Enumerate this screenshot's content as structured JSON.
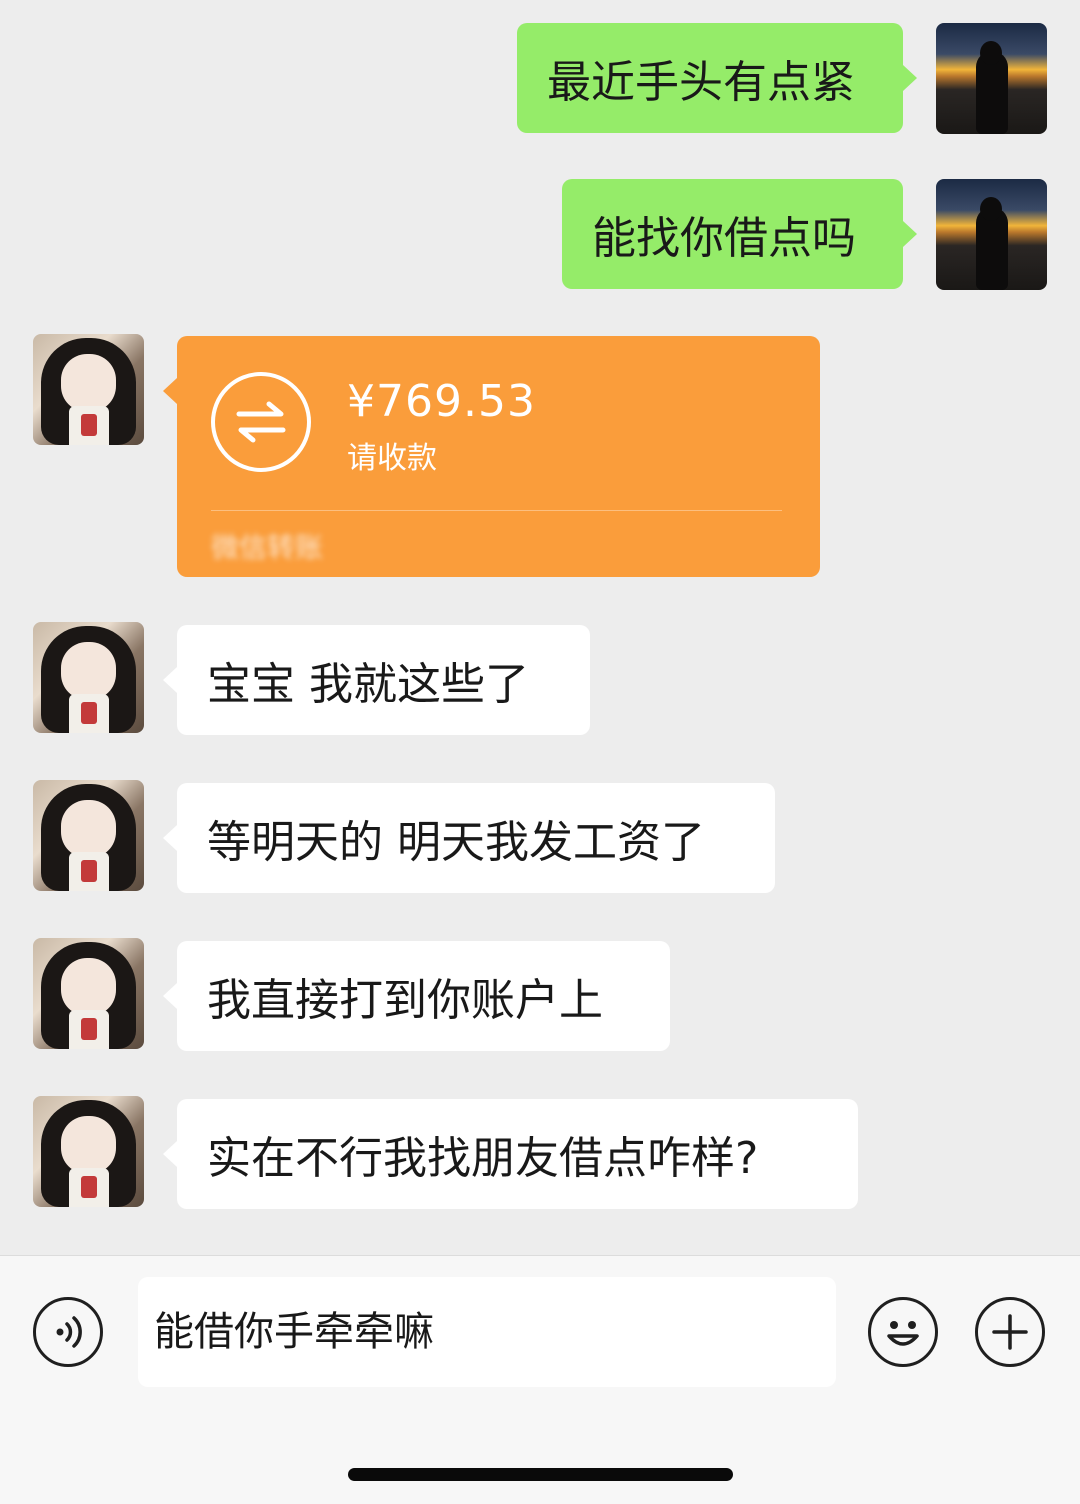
{
  "messages": [
    {
      "side": "right",
      "text": "最近手头有点紧"
    },
    {
      "side": "right",
      "text": "能找你借点吗"
    },
    {
      "side": "left",
      "type": "transfer",
      "amount": "¥769.53",
      "label": "请收款",
      "footer": "微信转账"
    },
    {
      "side": "left",
      "text": "宝宝 我就这些了"
    },
    {
      "side": "left",
      "text": "等明天的 明天我发工资了"
    },
    {
      "side": "left",
      "text": "我直接打到你账户上"
    },
    {
      "side": "left",
      "text": "实在不行我找朋友借点咋样?"
    }
  ],
  "input": {
    "value": "能借你手牵牵嘛"
  },
  "colors": {
    "self_bubble": "#95ec69",
    "other_bubble": "#ffffff",
    "transfer": "#fa9d3b",
    "background": "#ededed"
  },
  "icons": [
    "voice-icon",
    "emoji-icon",
    "plus-icon",
    "transfer-icon"
  ]
}
